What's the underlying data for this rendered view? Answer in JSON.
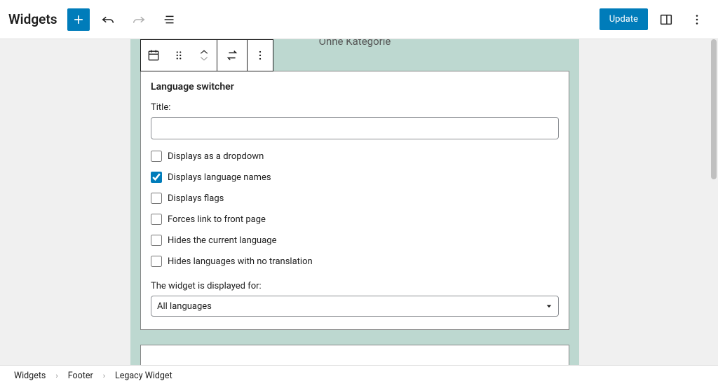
{
  "header": {
    "title": "Widgets",
    "update_label": "Update"
  },
  "canvas": {
    "hidden_category_text": "Ohne Kategorie"
  },
  "widget": {
    "panel_title": "Language switcher",
    "title_label": "Title:",
    "title_value": "",
    "checks": [
      {
        "label": "Displays as a dropdown",
        "checked": false
      },
      {
        "label": "Displays language names",
        "checked": true
      },
      {
        "label": "Displays flags",
        "checked": false
      },
      {
        "label": "Forces link to front page",
        "checked": false
      },
      {
        "label": "Hides the current language",
        "checked": false
      },
      {
        "label": "Hides languages with no translation",
        "checked": false
      }
    ],
    "display_for_label": "The widget is displayed for:",
    "display_for_value": "All languages"
  },
  "breadcrumb": {
    "items": [
      "Widgets",
      "Footer",
      "Legacy Widget"
    ]
  }
}
